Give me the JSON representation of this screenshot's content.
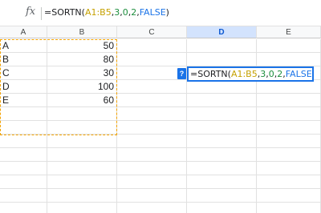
{
  "formula_bar": {
    "fx_label": "fx",
    "segments": [
      {
        "text": "=SORTN(",
        "kind": "fn"
      },
      {
        "text": "A1:B5",
        "kind": "range"
      },
      {
        "text": ",",
        "kind": "fn"
      },
      {
        "text": "3",
        "kind": "num"
      },
      {
        "text": ",",
        "kind": "fn"
      },
      {
        "text": "0",
        "kind": "num"
      },
      {
        "text": ",",
        "kind": "fn"
      },
      {
        "text": "2",
        "kind": "num"
      },
      {
        "text": ",",
        "kind": "fn"
      },
      {
        "text": "FALSE",
        "kind": "const"
      },
      {
        "text": ")",
        "kind": "fn"
      }
    ]
  },
  "columns": [
    "A",
    "B",
    "C",
    "D",
    "E"
  ],
  "selected_column": "D",
  "rows": [
    {
      "a": "A",
      "b": "50"
    },
    {
      "a": "B",
      "b": "80"
    },
    {
      "a": "C",
      "b": "30"
    },
    {
      "a": "D",
      "b": "100"
    },
    {
      "a": "E",
      "b": "60"
    }
  ],
  "editor": {
    "help_label": "?",
    "segments": [
      {
        "text": "=SORTN(",
        "kind": "fn"
      },
      {
        "text": "A1:B5",
        "kind": "range"
      },
      {
        "text": ",",
        "kind": "fn"
      },
      {
        "text": "3",
        "kind": "num"
      },
      {
        "text": ",",
        "kind": "fn"
      },
      {
        "text": "0",
        "kind": "num"
      },
      {
        "text": ",",
        "kind": "fn"
      },
      {
        "text": "2",
        "kind": "num"
      },
      {
        "text": ",",
        "kind": "fn"
      },
      {
        "text": "FALSE",
        "kind": "const"
      },
      {
        "text": ")",
        "kind": "fn"
      }
    ]
  },
  "colors": {
    "accent": "#1a73e8",
    "range_highlight": "#f4a300",
    "selected_header_bg": "#d3e3fd"
  }
}
